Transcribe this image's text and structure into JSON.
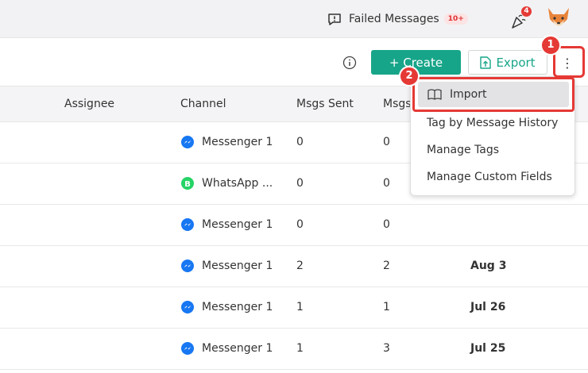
{
  "header": {
    "failed_messages_label": "Failed Messages",
    "failed_messages_badge": "10+",
    "notification_count": "4"
  },
  "toolbar": {
    "create_label": "+ Create",
    "export_label": "Export",
    "more_label": "⋮"
  },
  "table": {
    "columns": [
      "Assignee",
      "Channel",
      "Msgs Sent",
      "Msgs"
    ],
    "rows": [
      {
        "channel": "Messenger 1",
        "channel_type": "messenger",
        "sent": "0",
        "received": "0",
        "date": ""
      },
      {
        "channel": "WhatsApp ...",
        "channel_type": "whatsapp",
        "sent": "0",
        "received": "0",
        "date": ""
      },
      {
        "channel": "Messenger 1",
        "channel_type": "messenger",
        "sent": "0",
        "received": "0",
        "date": ""
      },
      {
        "channel": "Messenger 1",
        "channel_type": "messenger",
        "sent": "2",
        "received": "2",
        "date": "Aug 3"
      },
      {
        "channel": "Messenger 1",
        "channel_type": "messenger",
        "sent": "1",
        "received": "1",
        "date": "Jul 26"
      },
      {
        "channel": "Messenger 1",
        "channel_type": "messenger",
        "sent": "1",
        "received": "3",
        "date": "Jul 25"
      }
    ]
  },
  "dropdown": {
    "items": [
      "Import",
      "Tag by Message History",
      "Manage Tags",
      "Manage Custom Fields"
    ]
  },
  "annotations": {
    "step1": "1",
    "step2": "2"
  },
  "colors": {
    "accent": "#17a589",
    "highlight": "#e53935",
    "messenger": "#1877f2",
    "whatsapp": "#25d366"
  }
}
